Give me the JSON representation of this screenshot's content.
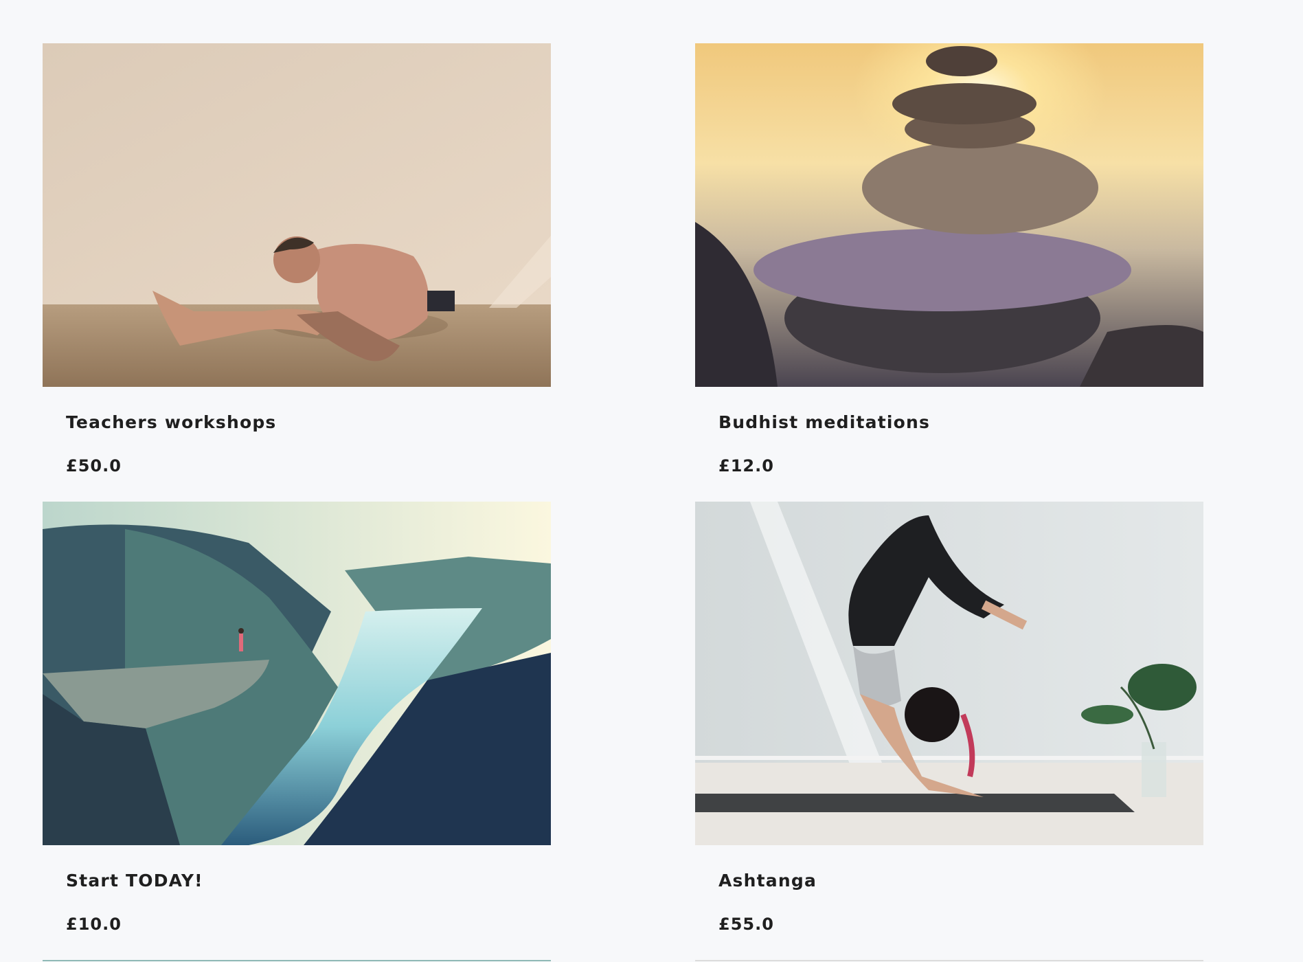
{
  "products": [
    {
      "title": "Teachers workshops",
      "price": "£50.0",
      "image": "yoga-man-stretching-photo"
    },
    {
      "title": "Budhist meditations",
      "price": "£12.0",
      "image": "stacked-stones-sunset-photo"
    },
    {
      "title": "Start TODAY!",
      "price": "£10.0",
      "image": "fjord-cliff-yoga-photo"
    },
    {
      "title": "Ashtanga",
      "price": "£55.0",
      "image": "woman-scorpion-pose-photo"
    }
  ],
  "colors": {
    "background": "#f7f8fa",
    "text": "#1f1f1f"
  }
}
